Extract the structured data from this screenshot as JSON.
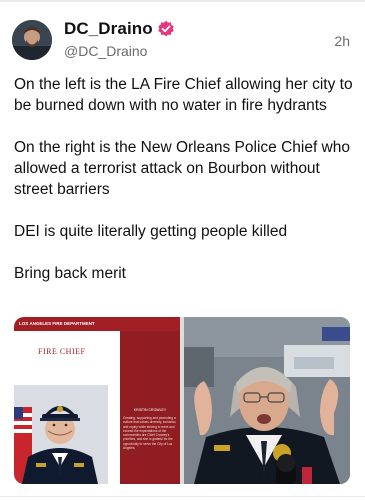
{
  "post": {
    "display_name": "DC_Draino",
    "handle": "@DC_Draino",
    "timestamp": "2h",
    "paragraphs": [
      "On the left is the LA Fire Chief allowing her city to be burned down with no water in fire hydrants",
      "On the right is the New Orleans Police Chief who allowed a terrorist attack on Bourbon without street barriers",
      "DEI is quite literally getting people killed",
      "Bring back merit"
    ]
  },
  "media": {
    "left_image": {
      "header_text": "LOS ANGELES FIRE DEPARTMENT",
      "title": "FIRE CHIEF",
      "name_caption": "KRISTIN CROWLEY",
      "body_caption": "Creating, supporting and promoting a culture that values diversity, inclusion, and equity while striving to meet and exceed the expectations of the communities are Chief Crowley's priorities, and she is grateful for the opportunity to serve the City of Los Angeles."
    }
  },
  "colors": {
    "verified_badge": "#e3387e",
    "lafd_red": "#a11f24"
  },
  "icons": {
    "verified": "verified-badge-icon"
  }
}
